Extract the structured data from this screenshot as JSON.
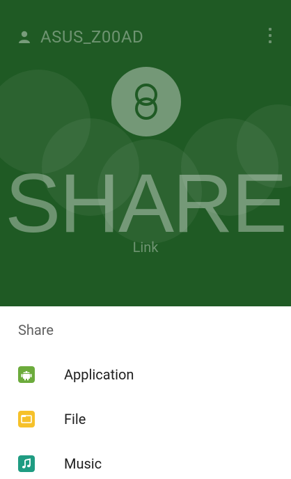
{
  "header": {
    "account_name": "ASUS_Z00AD",
    "account_icon": "user-icon",
    "menu_icon": "more-vert-icon"
  },
  "hero": {
    "logo_icon": "share-link-logo-icon",
    "title": "SHARE",
    "subtitle": "Link"
  },
  "sheet": {
    "title": "Share",
    "items": [
      {
        "label": "Application",
        "icon": "android-app-icon",
        "color": "#6cab3c"
      },
      {
        "label": "File",
        "icon": "folder-icon",
        "color": "#f6c12a"
      },
      {
        "label": "Music",
        "icon": "music-note-icon",
        "color": "#1f9c82"
      }
    ]
  },
  "colors": {
    "dim_background": "#1f5a24",
    "sheet_background": "#ffffff"
  }
}
